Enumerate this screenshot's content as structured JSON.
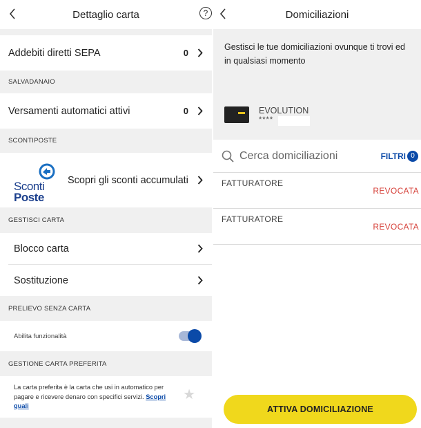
{
  "left": {
    "title": "Dettaglio carta",
    "help_symbol": "?",
    "sepa": {
      "label": "Addebiti diretti SEPA",
      "count": "0"
    },
    "salvadanaio": {
      "section": "SALVADANAIO",
      "label": "Versamenti automatici attivi",
      "count": "0"
    },
    "scontiposte": {
      "section": "SCONTIPOSTE",
      "logo_line1": "Sconti",
      "logo_line2": "Poste",
      "label": "Scopri gli sconti accumulati"
    },
    "gestisci": {
      "section": "GESTISCI CARTA",
      "items": [
        "Blocco carta",
        "Sostituzione"
      ]
    },
    "prelievo": {
      "section": "PRELIEVO SENZA CARTA",
      "toggle_label": "Abilita funzionalità",
      "toggle_on": true
    },
    "preferita": {
      "section": "GESTIONE CARTA PREFERITA",
      "text": "La carta preferita è la carta che usi in automatico per pagare e ricevere denaro con specifici servizi. ",
      "link": "Scopri quali"
    }
  },
  "right": {
    "title": "Domiciliazioni",
    "info_text": "Gestisci le tue domiciliazioni ovunque ti trovi ed in qualsiasi momento",
    "card": {
      "name": "EVOLUTION",
      "number": "****"
    },
    "search": {
      "placeholder": "Cerca domiciliazioni",
      "filter_label": "FILTRI",
      "filter_count": "0"
    },
    "items": [
      {
        "label": "FATTURATORE",
        "status": "REVOCATA"
      },
      {
        "label": "FATTURATORE",
        "status": "REVOCATA"
      }
    ],
    "cta": "ATTIVA DOMICILIAZIONE"
  },
  "colors": {
    "accent_blue": "#0b4aa8",
    "cta_yellow": "#f0d81c",
    "revoked_red": "#d6413a"
  }
}
